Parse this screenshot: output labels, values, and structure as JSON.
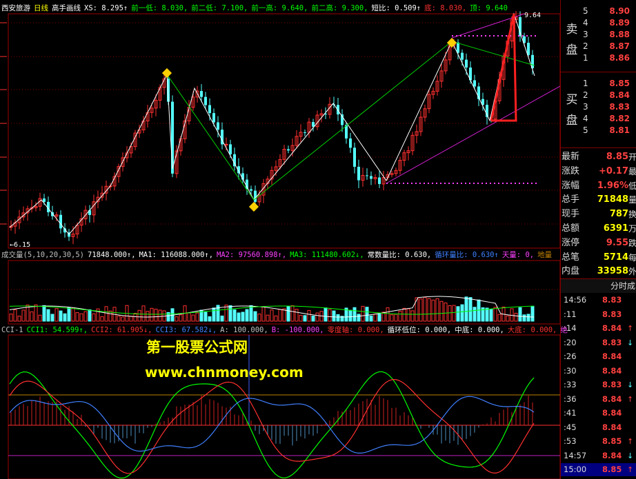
{
  "main_header": {
    "items": [
      {
        "text": "西安旅游",
        "color": "#ffffff"
      },
      {
        "text": "日线",
        "color": "#ffff00"
      },
      {
        "text": "高手画线",
        "color": "#ffffff"
      },
      {
        "text": "XS: 8.295↑",
        "color": "#ffffff"
      },
      {
        "text": "前一低: 8.030,",
        "color": "#00ff00"
      },
      {
        "text": "前二低: 7.100,",
        "color": "#00ff00"
      },
      {
        "text": "前一高: 9.640,",
        "color": "#00ff00"
      },
      {
        "text": "前二高: 9.300,",
        "color": "#00ff00"
      },
      {
        "text": "短比: 0.509↑",
        "color": "#ffffff"
      },
      {
        "text": "底: 8.030,",
        "color": "#ff3030"
      },
      {
        "text": "顶: 9.640",
        "color": "#00ff00"
      }
    ],
    "left_price_label": "←6.15",
    "top_price_label": "9.64"
  },
  "vol_header": {
    "items": [
      {
        "text": "成交量(5,10,20,30,5)",
        "color": "#c0c0c0"
      },
      {
        "text": "71848.000↑,",
        "color": "#ffffff"
      },
      {
        "text": "MA1: 116088.000↑,",
        "color": "#ffffff"
      },
      {
        "text": "MA2: 97560.898↑,",
        "color": "#ff40ff"
      },
      {
        "text": "MA3: 111480.602↓,",
        "color": "#00ff00"
      },
      {
        "text": "常数量比: 0.630,",
        "color": "#ffffff"
      },
      {
        "text": "循环量比: 0.630↑",
        "color": "#4080ff"
      },
      {
        "text": "天量: 0,",
        "color": "#ff40ff"
      },
      {
        "text": "地量",
        "color": "#c08000"
      }
    ]
  },
  "cci_header": {
    "items": [
      {
        "text": "CCI-1",
        "color": "#c0c0c0"
      },
      {
        "text": "CCI1: 54.599↑,",
        "color": "#00ff00"
      },
      {
        "text": "CCI2: 61.905↓,",
        "color": "#ff3030"
      },
      {
        "text": "CCI3: 67.582↓,",
        "color": "#4080ff"
      },
      {
        "text": "A: 100.000,",
        "color": "#c0c0c0"
      },
      {
        "text": "B: -100.000,",
        "color": "#ff40ff"
      },
      {
        "text": "零度轴: 0.000,",
        "color": "#ff3030"
      },
      {
        "text": "循环低位: 0.000,",
        "color": "#ffffff"
      },
      {
        "text": "中底: 0.000,",
        "color": "#ffffff"
      },
      {
        "text": "大底: 0.000,",
        "color": "#ff3030"
      },
      {
        "text": "绝",
        "color": "#ff40ff"
      }
    ]
  },
  "watermark": {
    "line1": "第一股票公式网",
    "line2": "www.chnmoney.com"
  },
  "order_book": {
    "sell_title": "卖\n盘",
    "buy_title": "买\n盘",
    "sell": [
      {
        "level": "5",
        "price": "8.90"
      },
      {
        "level": "4",
        "price": "8.89"
      },
      {
        "level": "3",
        "price": "8.88"
      },
      {
        "level": "2",
        "price": "8.87"
      },
      {
        "level": "1",
        "price": "8.86"
      }
    ],
    "buy": [
      {
        "level": "1",
        "price": "8.85"
      },
      {
        "level": "2",
        "price": "8.84"
      },
      {
        "level": "3",
        "price": "8.83"
      },
      {
        "level": "4",
        "price": "8.82"
      },
      {
        "level": "5",
        "price": "8.81"
      }
    ]
  },
  "quote": [
    {
      "key": "最新",
      "value": "8.85",
      "color": "#ff4040",
      "suffix": "开"
    },
    {
      "key": "涨跌",
      "value": "+0.17",
      "color": "#ff4040",
      "suffix": "最"
    },
    {
      "key": "涨幅",
      "value": "1.96%",
      "color": "#ff4040",
      "suffix": "低"
    },
    {
      "key": "总手",
      "value": "71848",
      "color": "#ffff00",
      "suffix": "量"
    },
    {
      "key": "现手",
      "value": "787",
      "color": "#ffff00",
      "suffix": "换"
    },
    {
      "key": "总额",
      "value": "6391",
      "color": "#ffff00",
      "suffix": "万"
    },
    {
      "key": "涨停",
      "value": "9.55",
      "color": "#ff4040",
      "suffix": "跌"
    },
    {
      "key": "总笔",
      "value": "5714",
      "color": "#ffff00",
      "suffix": "每"
    },
    {
      "key": "内盘",
      "value": "33958",
      "color": "#ffff00",
      "suffix": "外"
    }
  ],
  "ticks_title": "分时成",
  "ticks": [
    {
      "time": "14:56",
      "price": "8.83",
      "arrow": ""
    },
    {
      "time": ":11",
      "price": "8.83",
      "arrow": ""
    },
    {
      "time": ":14",
      "price": "8.84",
      "arrow": "↑"
    },
    {
      "time": ":20",
      "price": "8.83",
      "arrow": "↓"
    },
    {
      "time": ":26",
      "price": "8.84",
      "arrow": ""
    },
    {
      "time": ":30",
      "price": "8.84",
      "arrow": ""
    },
    {
      "time": ":33",
      "price": "8.83",
      "arrow": "↓"
    },
    {
      "time": ":36",
      "price": "8.84",
      "arrow": "↑"
    },
    {
      "time": ":41",
      "price": "8.84",
      "arrow": ""
    },
    {
      "time": ":45",
      "price": "8.84",
      "arrow": ""
    },
    {
      "time": ":53",
      "price": "8.85",
      "arrow": "↑"
    },
    {
      "time": "14:57",
      "price": "8.84",
      "arrow": "↓"
    },
    {
      "time": "15:00",
      "price": "8.85",
      "arrow": "↑"
    }
  ],
  "colors": {
    "up": "#ff3030",
    "down": "#54ffff",
    "grid": "#800000",
    "border": "#a00000"
  }
}
